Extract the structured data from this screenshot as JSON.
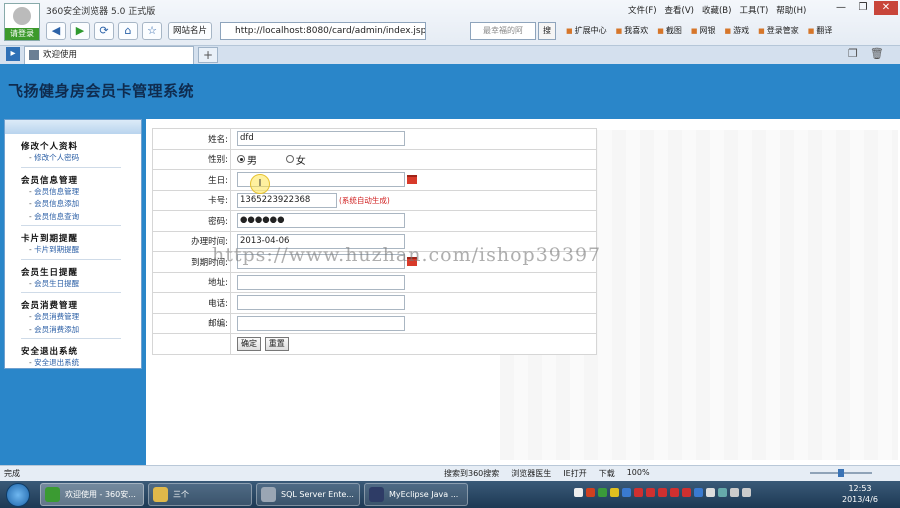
{
  "browser": {
    "title": "360安全浏览器 5.0 正式版",
    "login_label": "请登录",
    "menu": [
      "文件(F)",
      "查看(V)",
      "收藏(B)",
      "工具(T)",
      "帮助(H)"
    ],
    "window_buttons": [
      "—",
      "❐",
      "✕"
    ],
    "fav_label": "网站名片",
    "url": "http://localhost:8080/card/admin/index.jsp",
    "url_host": "localhost",
    "search_placeholder": "最幸福的阿",
    "search_button": "搜",
    "extensions": [
      "扩展中心",
      "我喜欢",
      "截图",
      "网银",
      "游戏",
      "登录管家",
      "翻译"
    ],
    "tab_label": "欢迎使用",
    "new_tab": "+"
  },
  "app": {
    "title": "飞扬健身房会员卡管理系统"
  },
  "sidebar": {
    "groups": [
      {
        "title": "修改个人资料",
        "items": [
          "修改个人密码"
        ]
      },
      {
        "title": "会员信息管理",
        "items": [
          "会员信息管理",
          "会员信息添加",
          "会员信息查询"
        ]
      },
      {
        "title": "卡片到期提醒",
        "items": [
          "卡片到期提醒"
        ]
      },
      {
        "title": "会员生日提醒",
        "items": [
          "会员生日提醒"
        ]
      },
      {
        "title": "会员消费管理",
        "items": [
          "会员消费管理",
          "会员消费添加"
        ]
      },
      {
        "title": "安全退出系统",
        "items": [
          "安全退出系统"
        ]
      }
    ]
  },
  "form": {
    "name_label": "姓名:",
    "name_value": "dfd",
    "gender_label": "性别:",
    "gender_male": "男",
    "gender_female": "女",
    "birthday_label": "生日:",
    "birthday_value": "",
    "card_label": "卡号:",
    "card_value": "1365223922368",
    "card_hint": "(系统自动生成)",
    "password_label": "密码:",
    "password_value": "●●●●●●",
    "issue_date_label": "办理时间:",
    "issue_date_value": "2013-04-06",
    "expire_date_label": "到期时间:",
    "expire_date_value": "",
    "address_label": "地址:",
    "address_value": "",
    "phone_label": "电话:",
    "phone_value": "",
    "email_label": "邮编:",
    "email_value": "",
    "submit_label": "确定",
    "reset_label": "重置"
  },
  "watermark": "https://www.huzhan.com/ishop39397",
  "statusbar": {
    "left": "完成",
    "items": [
      "搜索到360搜索",
      "浏览器医生",
      "IE打开",
      "下载",
      "100%"
    ]
  },
  "taskbar": {
    "tasks": [
      "欢迎使用 - 360安...",
      "三个",
      "SQL Server Ente...",
      "MyEclipse Java ..."
    ],
    "time": "12:53",
    "date": "2013/4/6"
  },
  "colors": {
    "header_blue": "#2a86c9",
    "title_color": "#0f2b4e",
    "link_blue": "#2a5ea5",
    "hint_red": "#d02020"
  }
}
